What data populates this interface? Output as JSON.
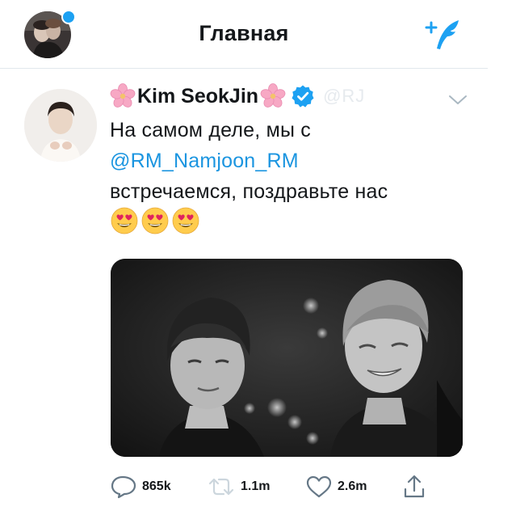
{
  "header": {
    "title": "Главная",
    "notification_dot_color": "#1da1f2",
    "compose_icon": "feather-plus-icon"
  },
  "tweet": {
    "display_name": "Kim SeokJin",
    "name_decoration_icon": "cherry-blossom-icon",
    "verified": true,
    "handle": "@RJ",
    "text_line1": "На самом деле, мы с",
    "mention": "@RM_Namjoon_RM",
    "text_line3": "встречаемся, поздравьте нас",
    "emojis": [
      "smiling-face-heart-eyes",
      "smiling-face-heart-eyes",
      "smiling-face-heart-eyes"
    ],
    "media": {
      "type": "photo",
      "tone": "black-and-white"
    }
  },
  "actions": {
    "replies": "865k",
    "retweets": "1.1m",
    "likes": "2.6m"
  },
  "colors": {
    "accent": "#1da1f2",
    "mention": "#1b95e0",
    "text": "#14171a",
    "divider": "#e1e8ed"
  }
}
